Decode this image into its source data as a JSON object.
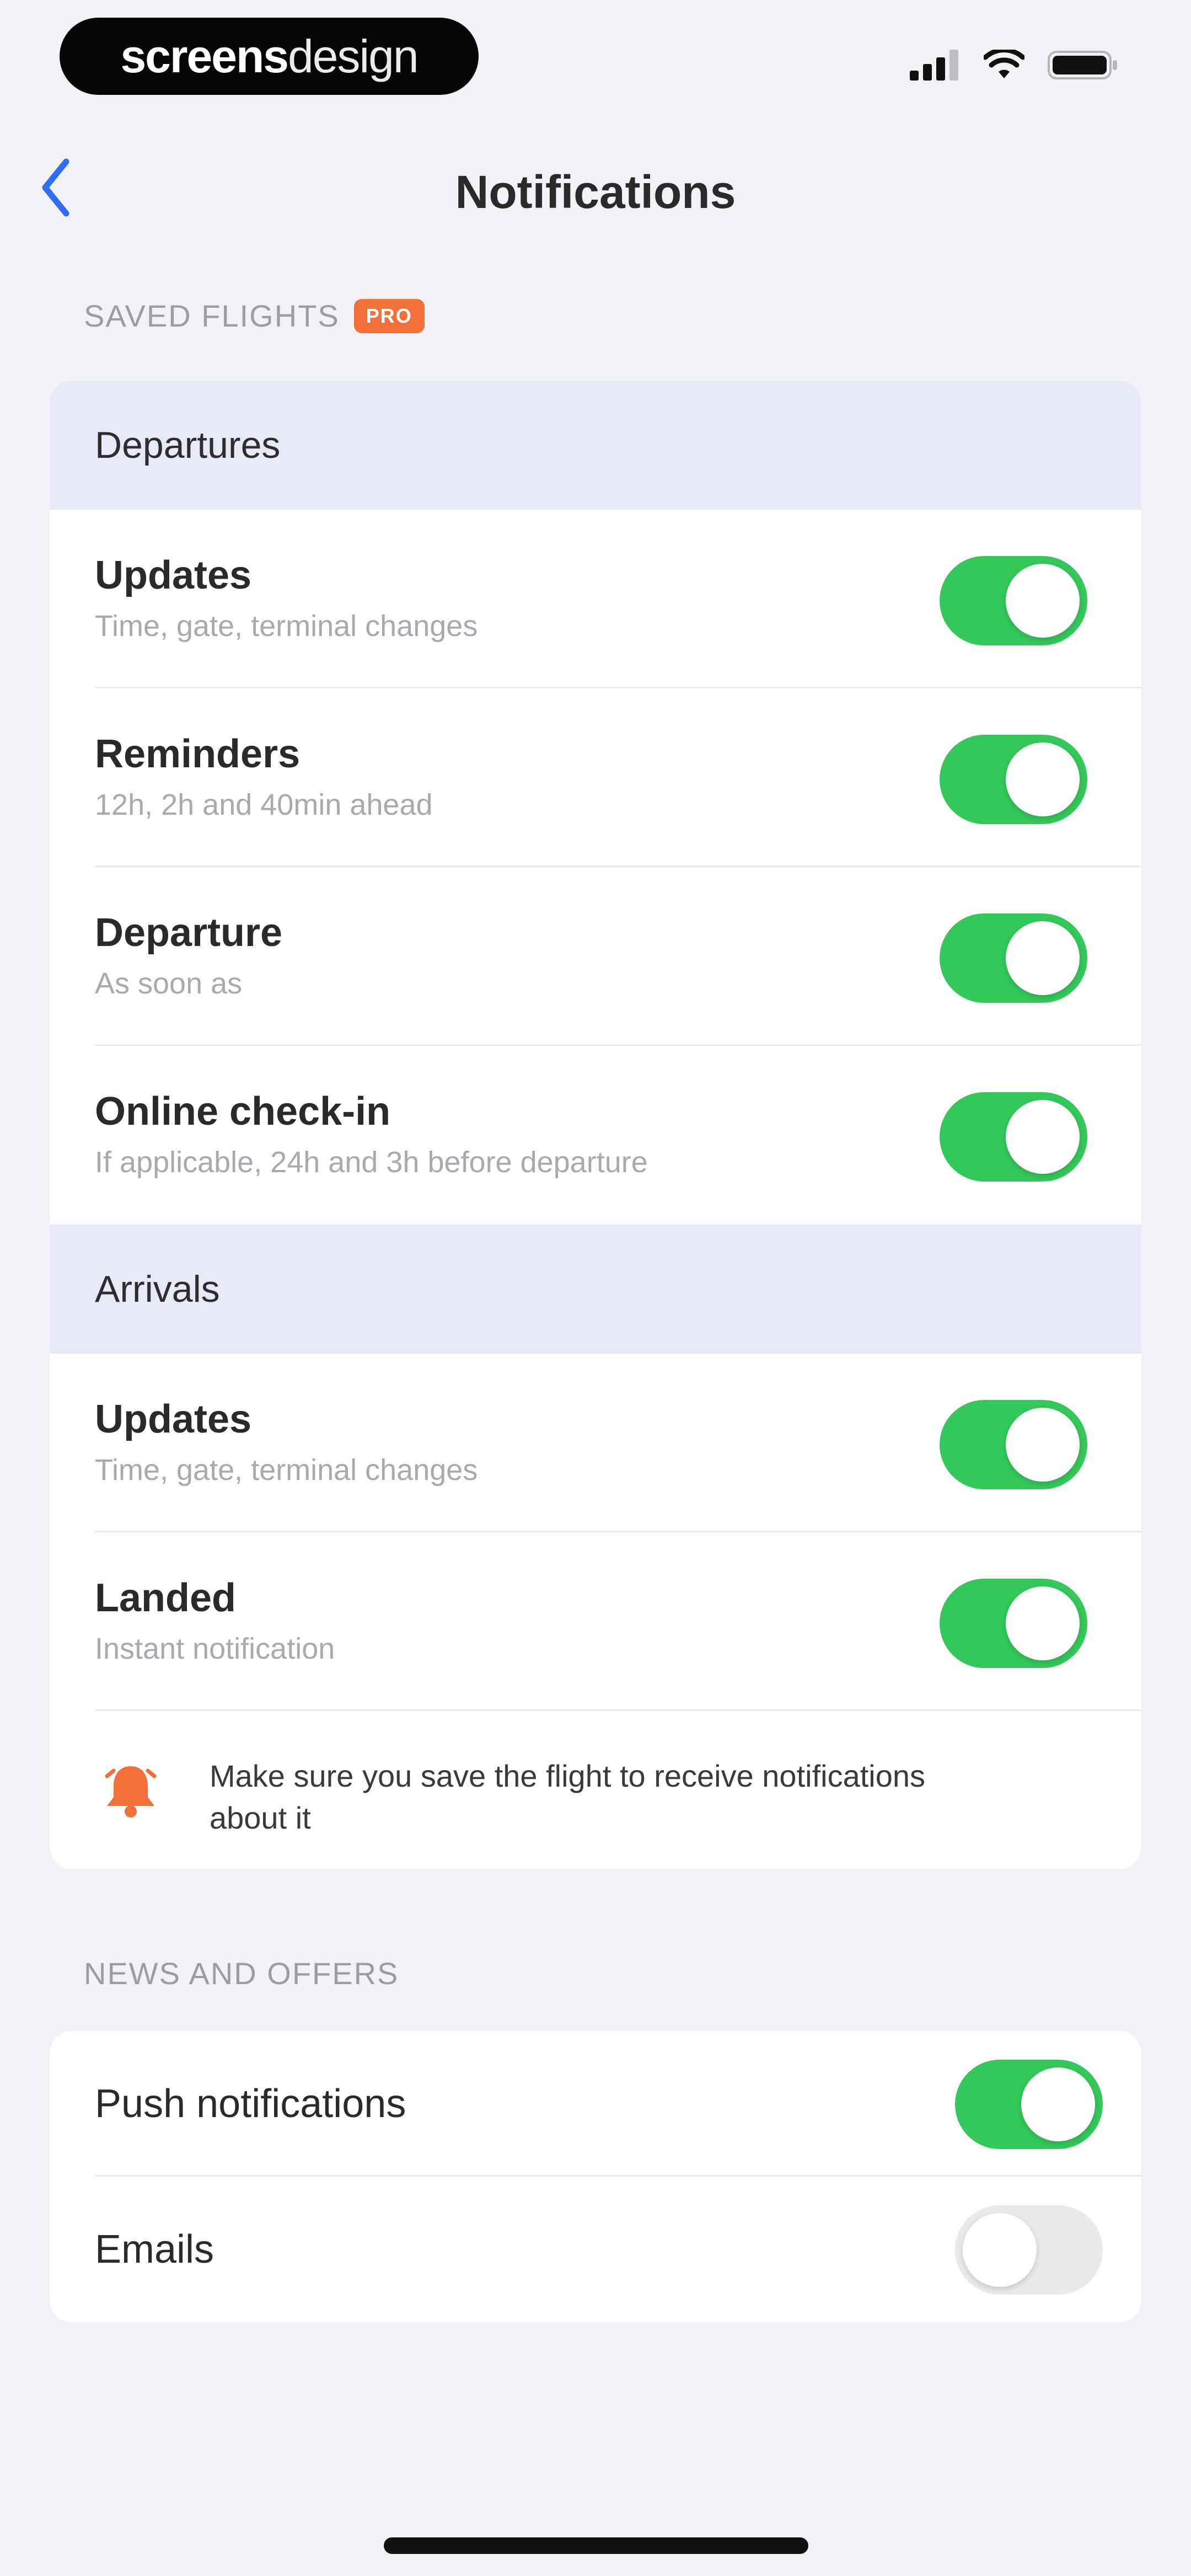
{
  "status_bar": {
    "brand_bold": "screens",
    "brand_light": "design",
    "icons": [
      "signal-icon",
      "wifi-icon",
      "battery-icon"
    ]
  },
  "nav": {
    "title": "Notifications",
    "back_icon": "chevron-left-icon"
  },
  "saved_flights": {
    "header": "SAVED FLIGHTS",
    "badge": "PRO",
    "departures": {
      "label": "Departures",
      "rows": [
        {
          "title": "Updates",
          "subtitle": "Time, gate, terminal changes",
          "enabled": true
        },
        {
          "title": "Reminders",
          "subtitle": "12h, 2h and 40min ahead",
          "enabled": true
        },
        {
          "title": "Departure",
          "subtitle": "As soon as",
          "enabled": true
        },
        {
          "title": "Online check-in",
          "subtitle": "If applicable, 24h and 3h before departure",
          "enabled": true
        }
      ]
    },
    "arrivals": {
      "label": "Arrivals",
      "rows": [
        {
          "title": "Updates",
          "subtitle": "Time, gate, terminal changes",
          "enabled": true
        },
        {
          "title": "Landed",
          "subtitle": "Instant notification",
          "enabled": true
        }
      ]
    },
    "info": {
      "icon": "bell-icon",
      "text": "Make sure you save the flight to receive notifications about it"
    }
  },
  "news_and_offers": {
    "header": "NEWS AND OFFERS",
    "rows": [
      {
        "title": "Push notifications",
        "enabled": true
      },
      {
        "title": "Emails",
        "enabled": false
      }
    ]
  },
  "colors": {
    "toggle_on": "#34c759",
    "toggle_off": "#e9e9eb",
    "accent": "#2f6df6",
    "badge": "#f26f3a",
    "group_header_bg": "#e8e9f6"
  }
}
